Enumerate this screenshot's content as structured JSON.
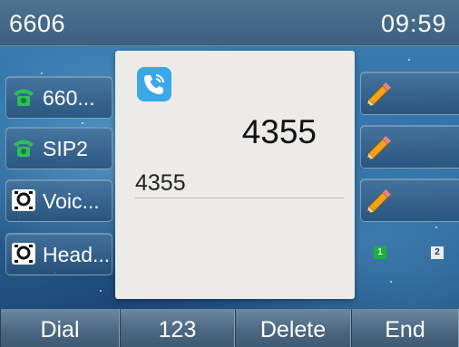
{
  "status_bar": {
    "account": "6606",
    "time": "09:59"
  },
  "line_keys": [
    {
      "label": "660...",
      "icon": "green-phone-icon"
    },
    {
      "label": "SIP2",
      "icon": "green-phone-icon"
    },
    {
      "label": "Voic...",
      "icon": "voicemail-icon"
    },
    {
      "label": "Head...",
      "icon": "headset-icon"
    }
  ],
  "right_keys": [
    {
      "icon": "pencil-icon"
    },
    {
      "icon": "pencil-icon"
    },
    {
      "icon": "pencil-icon"
    }
  ],
  "pages": {
    "page1": "1",
    "page2": "2",
    "active_color": "#1fae3b"
  },
  "dialog": {
    "icon": "call-icon",
    "contact": "4355",
    "number": "4355"
  },
  "soft_keys": {
    "dial": "Dial",
    "mode": "123",
    "delete": "Delete",
    "end": "End"
  }
}
